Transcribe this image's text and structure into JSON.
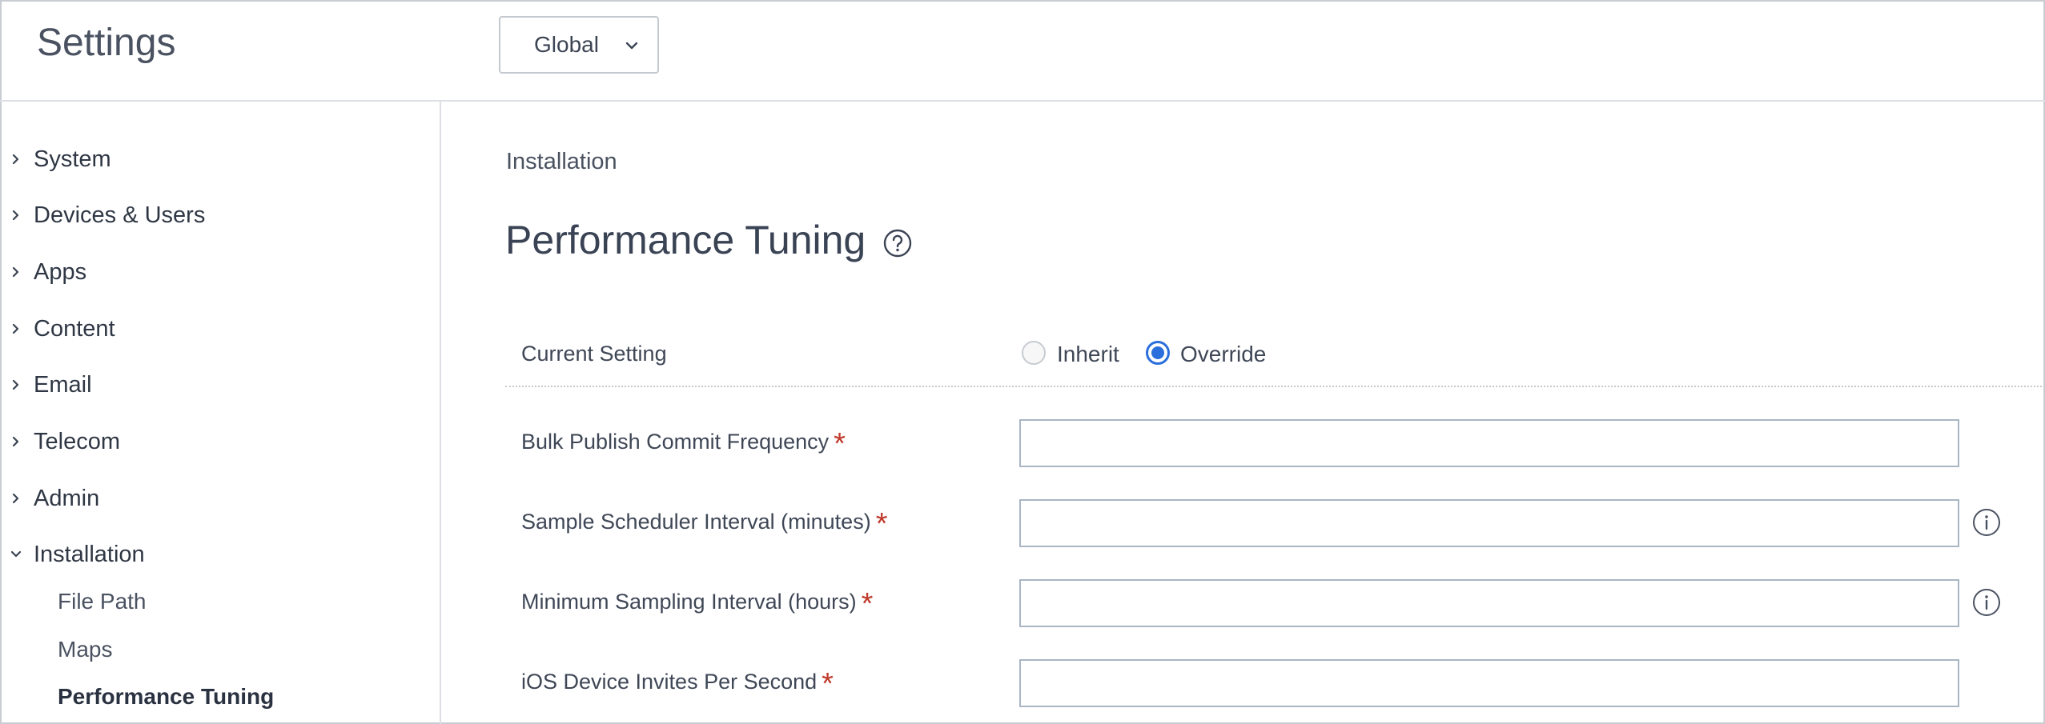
{
  "header": {
    "title": "Settings",
    "scope_select": {
      "value": "Global"
    }
  },
  "sidebar": {
    "items": [
      {
        "label": "System",
        "expanded": false
      },
      {
        "label": "Devices & Users",
        "expanded": false
      },
      {
        "label": "Apps",
        "expanded": false
      },
      {
        "label": "Content",
        "expanded": false
      },
      {
        "label": "Email",
        "expanded": false
      },
      {
        "label": "Telecom",
        "expanded": false
      },
      {
        "label": "Admin",
        "expanded": false
      },
      {
        "label": "Installation",
        "expanded": true
      }
    ],
    "installation_children": [
      {
        "label": "File Path"
      },
      {
        "label": "Maps"
      },
      {
        "label": "Performance Tuning",
        "active": true
      }
    ]
  },
  "main": {
    "breadcrumb": "Installation",
    "title": "Performance Tuning",
    "current_setting": {
      "label": "Current Setting",
      "options": [
        "Inherit",
        "Override"
      ],
      "selected": "Override"
    },
    "fields": [
      {
        "label": "Bulk Publish Commit Frequency",
        "value": "",
        "required": true,
        "info": false
      },
      {
        "label": "Sample Scheduler Interval (minutes)",
        "value": "",
        "required": true,
        "info": true
      },
      {
        "label": "Minimum Sampling Interval (hours)",
        "value": "",
        "required": true,
        "info": true
      },
      {
        "label": "iOS Device Invites Per Second",
        "value": "",
        "required": true,
        "info": false
      }
    ],
    "required_marker": "*"
  },
  "colors": {
    "accent": "#2a6fdb",
    "required": "#c0392b",
    "input_border": "#aab6c4"
  }
}
